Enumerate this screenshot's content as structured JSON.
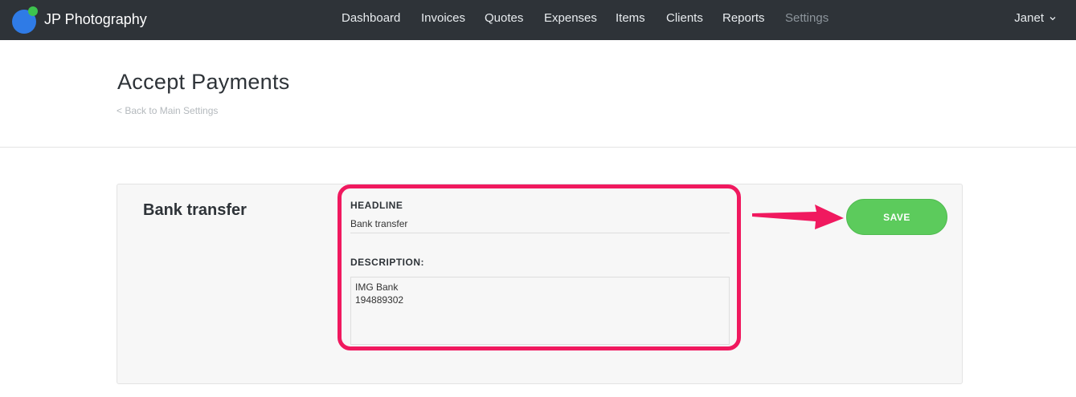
{
  "app": {
    "brand_name": "JP Photography",
    "user_name": "Janet"
  },
  "nav": {
    "items": [
      {
        "label": "Dashboard",
        "active": false
      },
      {
        "label": "Invoices",
        "active": false
      },
      {
        "label": "Quotes",
        "active": false
      },
      {
        "label": "Expenses",
        "active": false
      },
      {
        "label": "Items",
        "active": false
      },
      {
        "label": "Clients",
        "active": false
      },
      {
        "label": "Reports",
        "active": false
      },
      {
        "label": "Settings",
        "active": true
      }
    ]
  },
  "page": {
    "title": "Accept Payments",
    "back_link": "< Back to Main Settings"
  },
  "card": {
    "title": "Bank transfer",
    "headline_label": "HEADLINE",
    "headline_value": "Bank transfer",
    "description_label": "DESCRIPTION:",
    "description_value": "IMG Bank\n194889302",
    "save_label": "SAVE"
  },
  "colors": {
    "topbar": "#2e3338",
    "accent_green": "#5ccb5c",
    "annotation_pink": "#f0195f",
    "logo_blue": "#2f7be6",
    "logo_green": "#3dc34e"
  },
  "icons": {
    "logo": "jp-photography-logo",
    "user_dropdown": "chevron-down-icon",
    "annotation_arrow": "arrow-right-icon"
  }
}
